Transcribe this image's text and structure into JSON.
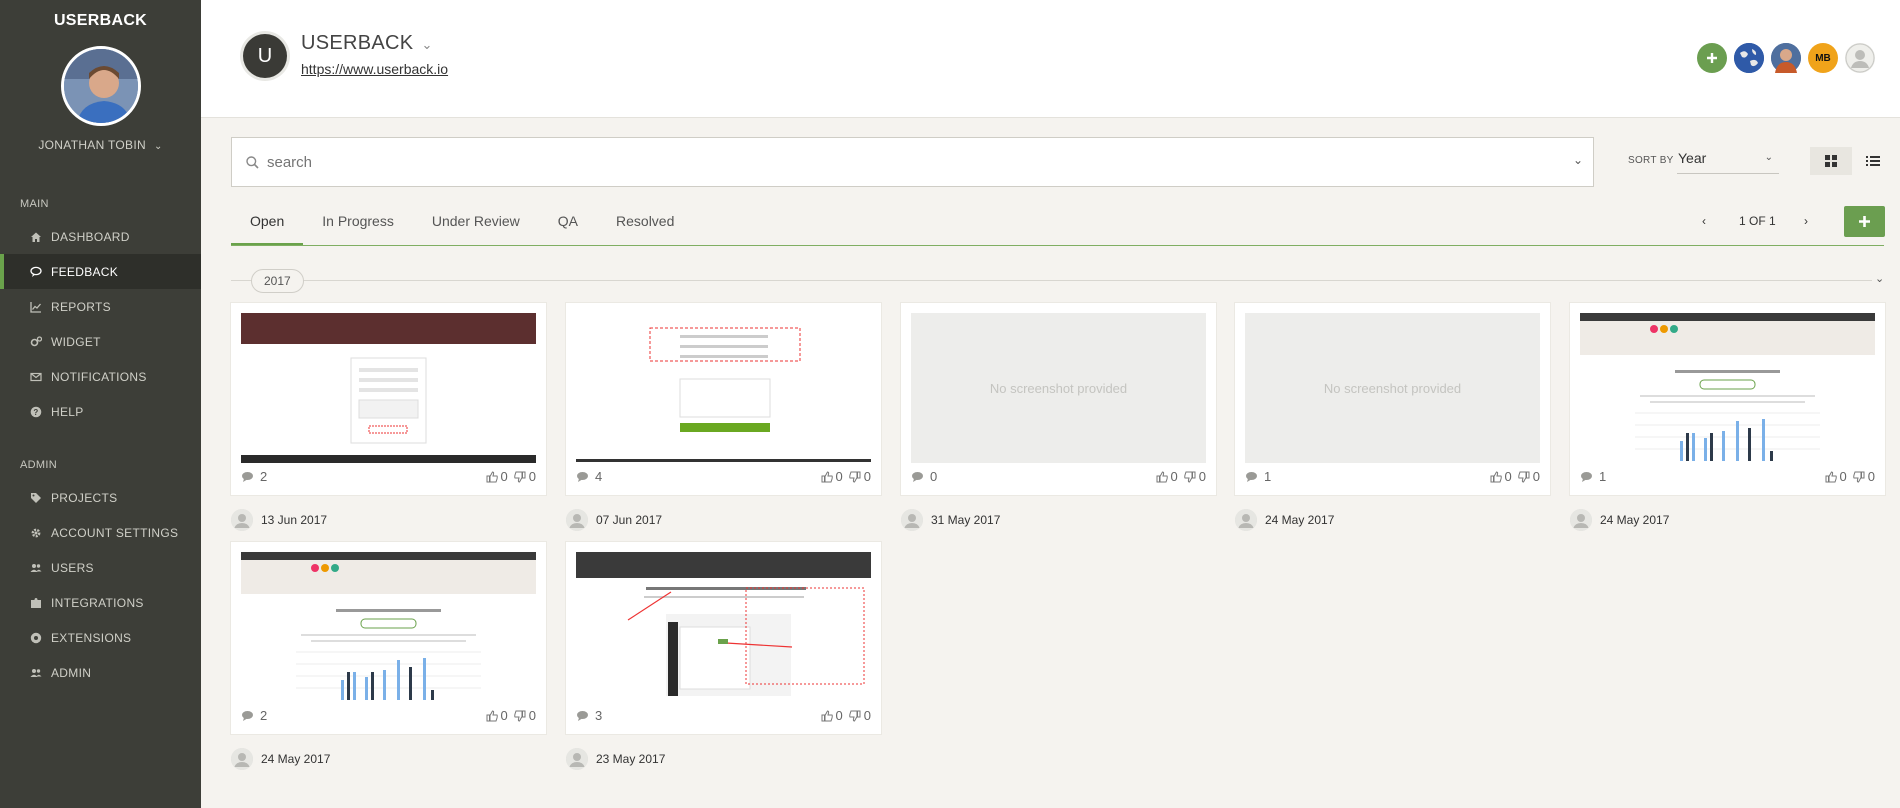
{
  "app": {
    "brand": "USERBACK"
  },
  "sidebar": {
    "user_name": "JONATHAN TOBIN",
    "main_label": "MAIN",
    "admin_label": "ADMIN",
    "main_items": [
      {
        "label": "DASHBOARD",
        "icon": "home-icon"
      },
      {
        "label": "FEEDBACK",
        "icon": "chat-icon"
      },
      {
        "label": "REPORTS",
        "icon": "chart-icon"
      },
      {
        "label": "WIDGET",
        "icon": "gears-icon"
      },
      {
        "label": "NOTIFICATIONS",
        "icon": "envelope-icon"
      },
      {
        "label": "HELP",
        "icon": "question-icon"
      }
    ],
    "admin_items": [
      {
        "label": "PROJECTS",
        "icon": "tags-icon"
      },
      {
        "label": "ACCOUNT SETTINGS",
        "icon": "gear-icon"
      },
      {
        "label": "USERS",
        "icon": "users-icon"
      },
      {
        "label": "INTEGRATIONS",
        "icon": "puzzle-icon"
      },
      {
        "label": "EXTENSIONS",
        "icon": "chrome-icon"
      },
      {
        "label": "ADMIN",
        "icon": "users-icon"
      }
    ]
  },
  "header": {
    "project_initial": "U",
    "project_name": "USERBACK",
    "project_url": "https://www.userback.io",
    "members": [
      "MB"
    ]
  },
  "search": {
    "placeholder": "search",
    "value": ""
  },
  "sort": {
    "label": "SORT BY",
    "value": "Year"
  },
  "tabs": [
    "Open",
    "In Progress",
    "Under Review",
    "QA",
    "Resolved"
  ],
  "pager": {
    "text": "1 OF 1"
  },
  "groups": [
    {
      "year": "2017"
    }
  ],
  "cards": [
    {
      "comments": "2",
      "likes": "0",
      "dislikes": "0",
      "date": "13 Jun 2017",
      "thumb": "form-dark"
    },
    {
      "comments": "4",
      "likes": "0",
      "dislikes": "0",
      "date": "07 Jun 2017",
      "thumb": "form-green"
    },
    {
      "comments": "0",
      "likes": "0",
      "dislikes": "0",
      "date": "31 May 2017",
      "thumb": "none",
      "empty_text": "No screenshot provided"
    },
    {
      "comments": "1",
      "likes": "0",
      "dislikes": "0",
      "date": "24 May 2017",
      "thumb": "none",
      "empty_text": "No screenshot provided"
    },
    {
      "comments": "1",
      "likes": "0",
      "dislikes": "0",
      "date": "24 May 2017",
      "thumb": "bars"
    },
    {
      "comments": "2",
      "likes": "0",
      "dislikes": "0",
      "date": "24 May 2017",
      "thumb": "bars"
    },
    {
      "comments": "3",
      "likes": "0",
      "dislikes": "0",
      "date": "23 May 2017",
      "thumb": "dashboard"
    }
  ],
  "colors": {
    "sidebar": "#3d3e38",
    "accent": "#6aa24b",
    "add_button": "#6b9e50"
  }
}
